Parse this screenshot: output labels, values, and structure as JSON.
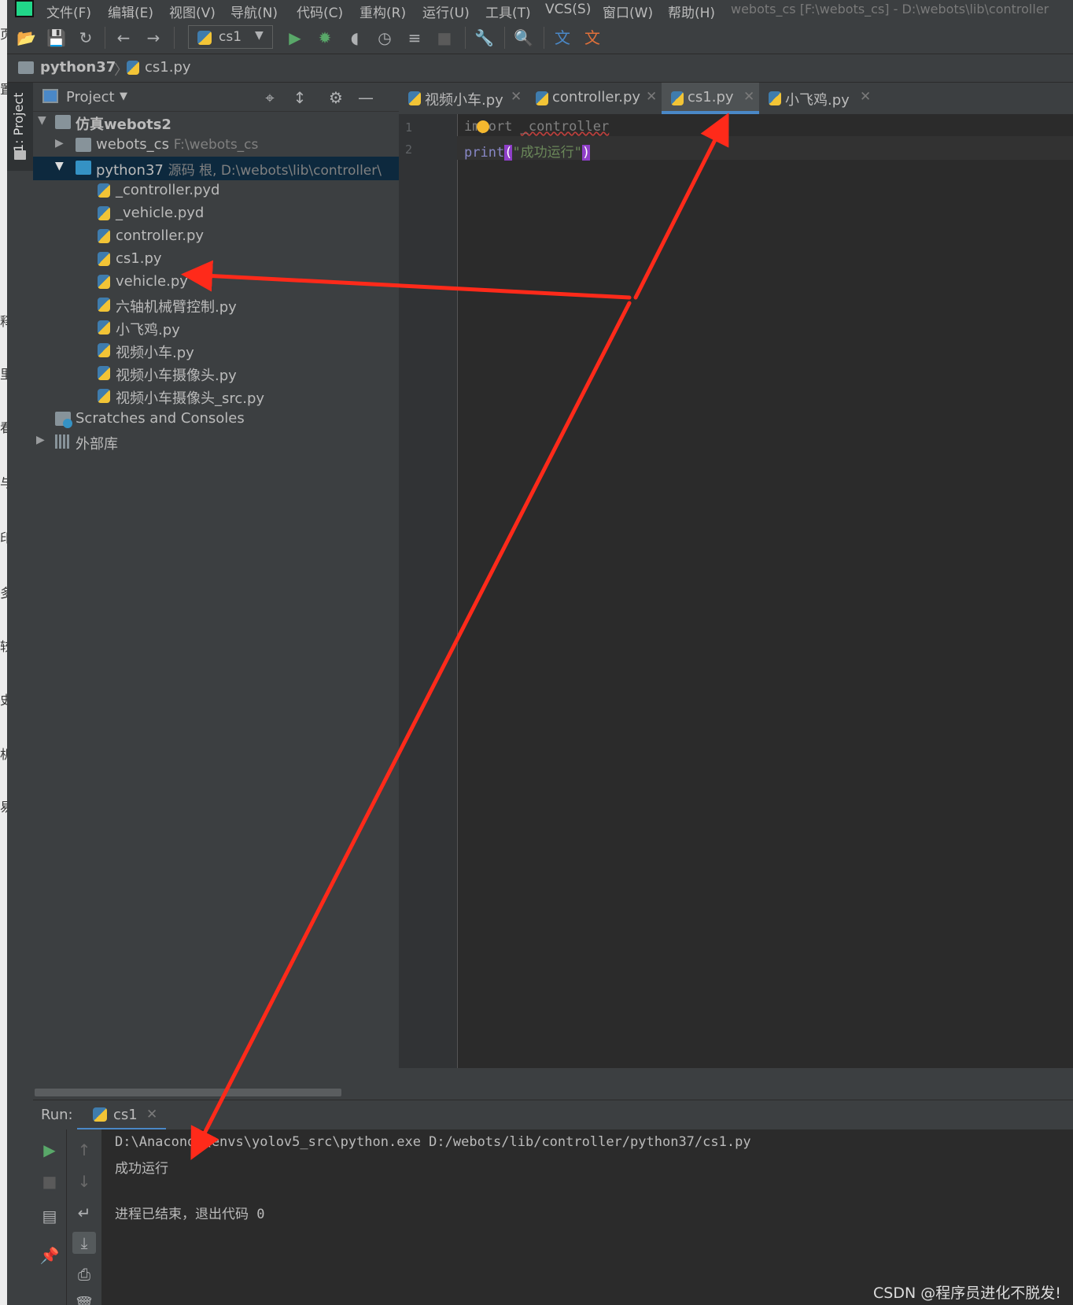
{
  "strip_chars": [
    "置",
    "页",
    "释",
    "里",
    "看",
    "与",
    "印",
    "多",
    "较",
    "史",
    "机",
    "易"
  ],
  "menu": [
    "文件(F)",
    "编辑(E)",
    "视图(V)",
    "导航(N)",
    "代码(C)",
    "重构(R)",
    "运行(U)",
    "工具(T)",
    "VCS(S)",
    "窗口(W)",
    "帮助(H)"
  ],
  "window_title": "webots_cs [F:\\webots_cs] - D:\\webots\\lib\\controller",
  "run_config": "cs1",
  "breadcrumb": [
    "python37",
    "cs1.py"
  ],
  "side_tab": "1: Project",
  "project": {
    "title": "Project",
    "tree": [
      {
        "label": "仿真webots2",
        "hint": ""
      },
      {
        "label": "webots_cs",
        "hint": "F:\\webots_cs"
      },
      {
        "label": "python37",
        "hint": "源码 根, D:\\webots\\lib\\controller\\"
      },
      {
        "label": "_controller.pyd",
        "hint": ""
      },
      {
        "label": "_vehicle.pyd",
        "hint": ""
      },
      {
        "label": "controller.py",
        "hint": ""
      },
      {
        "label": "cs1.py",
        "hint": ""
      },
      {
        "label": "vehicle.py",
        "hint": ""
      },
      {
        "label": "六轴机械臂控制.py",
        "hint": ""
      },
      {
        "label": "小飞鸡.py",
        "hint": ""
      },
      {
        "label": "视频小车.py",
        "hint": ""
      },
      {
        "label": "视频小车摄像头.py",
        "hint": ""
      },
      {
        "label": "视频小车摄像头_src.py",
        "hint": ""
      },
      {
        "label": "Scratches and Consoles",
        "hint": ""
      },
      {
        "label": "外部库",
        "hint": ""
      }
    ]
  },
  "tabs": [
    "视频小车.py",
    "controller.py",
    "cs1.py",
    "小飞鸡.py"
  ],
  "editor": {
    "line_numbers": [
      "1",
      "2"
    ],
    "line1": {
      "kw": "import",
      "mod": "_controller"
    },
    "line2": {
      "fn": "print",
      "open": "(",
      "str": "\"成功运行\"",
      "close": ")"
    }
  },
  "run": {
    "label": "Run:",
    "tab": "cs1",
    "lines": [
      "D:\\Anaconda\\envs\\yolov5_src\\python.exe D:/webots/lib/controller/python37/cs1.py",
      "成功运行",
      "",
      "进程已结束，退出代码 0"
    ]
  },
  "watermark": "CSDN @程序员进化不脱发!",
  "colors": {
    "accent": "#4a88c7",
    "arrow": "#ff2a1a",
    "keyword": "#cc7832",
    "string": "#6a8759",
    "selection": "#0d293e"
  }
}
